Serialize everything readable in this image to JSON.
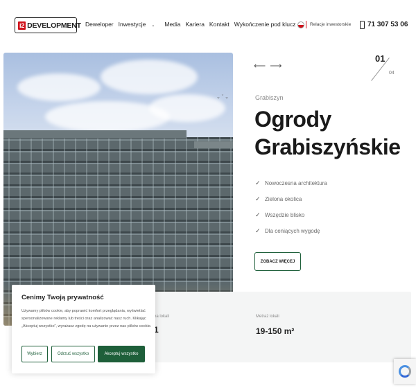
{
  "header": {
    "logo": {
      "mark": "i2",
      "text": "DEVELOPMENT"
    },
    "nav": [
      {
        "label": "Deweloper"
      },
      {
        "label": "Inwestycje",
        "has_dropdown": true
      },
      {
        "label": "Media"
      },
      {
        "label": "Kariera"
      },
      {
        "label": "Kontakt"
      },
      {
        "label": "Wykończenie pod klucz"
      }
    ],
    "investor_link": "Relacje inwestorskie",
    "phone": "71 307 53 06"
  },
  "slider": {
    "prev_arrow": "⟵",
    "next_arrow": "⟶",
    "current": "01",
    "total": "04"
  },
  "project": {
    "location": "Grabiszyn",
    "title_line1": "Ogrody",
    "title_line2": "Grabiszyńskie",
    "features": [
      "Nowoczesna architektura",
      "Zielona okolica",
      "Wszędzie blisko",
      "Dla ceniących wygodę"
    ],
    "cta": "ZOBACZ WIĘCEJ"
  },
  "stats": [
    {
      "label": "ba lokali",
      "value": "1"
    },
    {
      "label": "Metraż lokali",
      "value": "19-150 m²"
    }
  ],
  "cookie": {
    "title": "Cenimy Twoją prywatność",
    "text": "Używamy plików cookie, aby poprawić komfort przeglądania, wyświetlać spersonalizowane reklamy lub treści oraz analizować nasz ruch. Klikając „Akceptuj wszystko”, wyrażasz zgodę na używanie przez nas plików cookie.",
    "btn_customize": "Wybierz",
    "btn_reject": "Odrzuć wszystko",
    "btn_accept": "Akceptuj wszystko"
  },
  "colors": {
    "brand_red": "#d0121b",
    "accent_green": "#1e5f3a"
  }
}
